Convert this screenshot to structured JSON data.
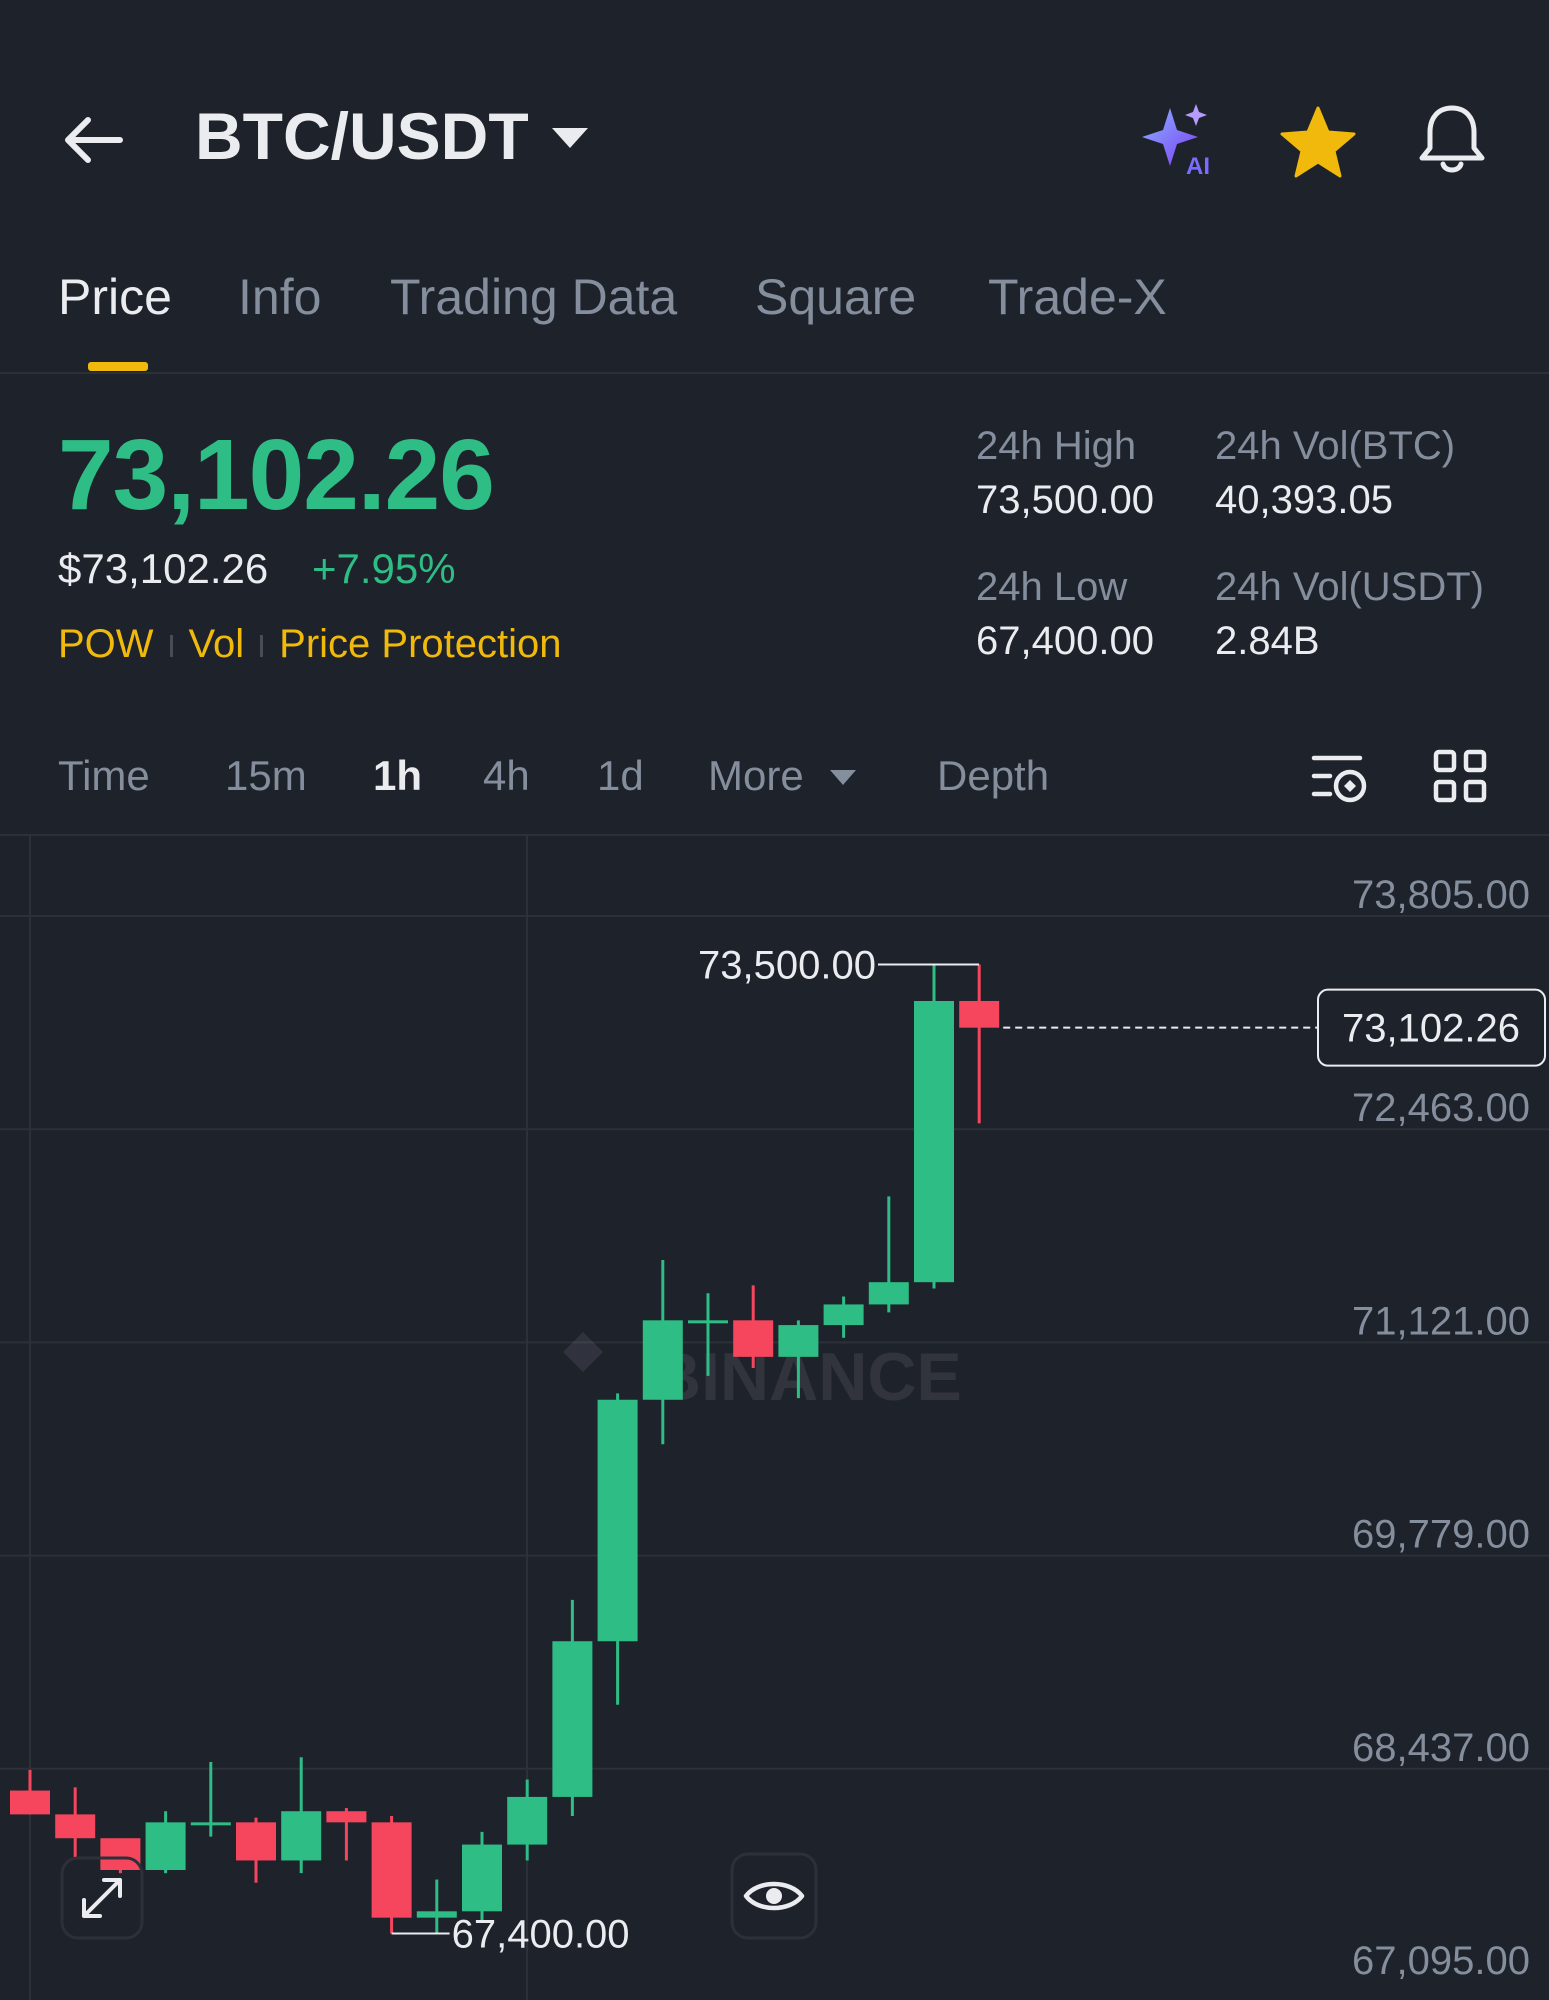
{
  "header": {
    "pair": "BTC/USDT",
    "icons": [
      "back-arrow-icon",
      "chevron-down-icon",
      "ai-sparkle-icon",
      "star-icon",
      "bell-icon"
    ],
    "ai_badge": "AI"
  },
  "tabs": [
    "Price",
    "Info",
    "Trading Data",
    "Square",
    "Trade-X"
  ],
  "active_tab": "Price",
  "ticker": {
    "price": "73,102.26",
    "usd_price": "$73,102.26",
    "change": "+7.95%",
    "tags": [
      "POW",
      "Vol",
      "Price Protection"
    ]
  },
  "stats": {
    "high_label": "24h High",
    "high": "73,500.00",
    "vol_btc_label": "24h Vol(BTC)",
    "vol_btc": "40,393.05",
    "low_label": "24h Low",
    "low": "67,400.00",
    "vol_usdt_label": "24h Vol(USDT)",
    "vol_usdt": "2.84B"
  },
  "timeframes": [
    "Time",
    "15m",
    "1h",
    "4h",
    "1d",
    "More",
    "Depth"
  ],
  "active_timeframe": "1h",
  "colors": {
    "up": "#2ebd85",
    "down": "#f6465d",
    "accent": "#f0b90b",
    "background": "#1e222b"
  },
  "chart_data": {
    "type": "candlestick",
    "interval": "1h",
    "y_ticks": [
      "73,805.00",
      "72,463.00",
      "71,121.00",
      "69,779.00",
      "68,437.00",
      "67,095.00"
    ],
    "y_tick_values": [
      73805,
      72463,
      71121,
      69779,
      68437,
      67095
    ],
    "ylim": [
      67095,
      73805
    ],
    "current_price": "73,102.26",
    "high_label": "73,500.00",
    "low_label": "67,400.00",
    "watermark": "BINANCE",
    "grid": true,
    "candles": [
      {
        "o": 68300,
        "h": 68430,
        "l": 68150,
        "c": 68150
      },
      {
        "o": 68150,
        "h": 68320,
        "l": 67880,
        "c": 68000
      },
      {
        "o": 68000,
        "h": 67940,
        "l": 67780,
        "c": 67800
      },
      {
        "o": 67800,
        "h": 68170,
        "l": 67780,
        "c": 68100
      },
      {
        "o": 68100,
        "h": 68480,
        "l": 68010,
        "c": 68100
      },
      {
        "o": 68100,
        "h": 68130,
        "l": 67720,
        "c": 67860
      },
      {
        "o": 67860,
        "h": 68510,
        "l": 67780,
        "c": 68170
      },
      {
        "o": 68170,
        "h": 68190,
        "l": 67860,
        "c": 68100
      },
      {
        "o": 68100,
        "h": 68140,
        "l": 67400,
        "c": 67500
      },
      {
        "o": 67500,
        "h": 67740,
        "l": 67400,
        "c": 67540
      },
      {
        "o": 67540,
        "h": 68040,
        "l": 67480,
        "c": 67960
      },
      {
        "o": 67960,
        "h": 68370,
        "l": 67860,
        "c": 68260
      },
      {
        "o": 68260,
        "h": 69500,
        "l": 68140,
        "c": 69240
      },
      {
        "o": 69240,
        "h": 70800,
        "l": 68840,
        "c": 70760
      },
      {
        "o": 70760,
        "h": 71640,
        "l": 70480,
        "c": 71260
      },
      {
        "o": 71260,
        "h": 71430,
        "l": 70910,
        "c": 71260
      },
      {
        "o": 71260,
        "h": 71480,
        "l": 70960,
        "c": 71030
      },
      {
        "o": 71030,
        "h": 71260,
        "l": 70770,
        "c": 71230
      },
      {
        "o": 71230,
        "h": 71410,
        "l": 71150,
        "c": 71360
      },
      {
        "o": 71360,
        "h": 72040,
        "l": 71310,
        "c": 71500
      },
      {
        "o": 71500,
        "h": 73500,
        "l": 71460,
        "c": 73270
      },
      {
        "o": 73270,
        "h": 73500,
        "l": 72500,
        "c": 73102
      }
    ]
  }
}
